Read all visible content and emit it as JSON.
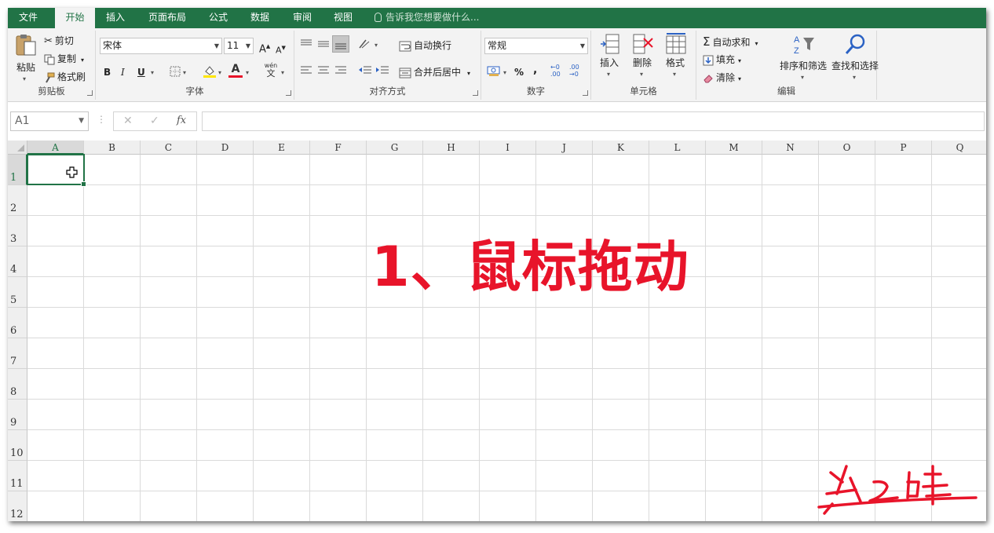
{
  "ribbon_tabs": [
    {
      "label": "文件"
    },
    {
      "label": "开始"
    },
    {
      "label": "插入"
    },
    {
      "label": "页面布局"
    },
    {
      "label": "公式"
    },
    {
      "label": "数据"
    },
    {
      "label": "审阅"
    },
    {
      "label": "视图"
    }
  ],
  "tell_me": "告诉我您想要做什么...",
  "clipboard": {
    "paste": "粘贴",
    "cut": "剪切",
    "copy": "复制",
    "format_painter": "格式刷",
    "group_label": "剪贴板"
  },
  "font": {
    "font_name": "宋体",
    "font_size": "11",
    "bold": "B",
    "italic": "I",
    "underline": "U",
    "grow": "A",
    "shrink": "A",
    "font_color_letter": "A",
    "phonetic_top": "wén",
    "phonetic_bottom": "文",
    "group_label": "字体"
  },
  "alignment": {
    "wrap_text": "自动换行",
    "merge_center": "合并后居中",
    "group_label": "对齐方式"
  },
  "number": {
    "format": "常规",
    "percent": "%",
    "comma": ",",
    "group_label": "数字"
  },
  "cells": {
    "insert": "插入",
    "delete": "删除",
    "format": "格式",
    "group_label": "单元格"
  },
  "editing": {
    "autosum": "自动求和",
    "fill": "填充",
    "clear": "清除",
    "sort_filter": "排序和筛选",
    "find_select": "查找和选择",
    "group_label": "编辑"
  },
  "formula_bar": {
    "name_box": "A1",
    "cancel": "✕",
    "enter": "✓",
    "fx": "fx",
    "formula": ""
  },
  "sheet": {
    "columns": [
      "A",
      "B",
      "C",
      "D",
      "E",
      "F",
      "G",
      "H",
      "I",
      "J",
      "K",
      "L",
      "M",
      "N",
      "O",
      "P",
      "Q"
    ],
    "rows": [
      "1",
      "2",
      "3",
      "4",
      "5",
      "6",
      "7",
      "8",
      "9",
      "10",
      "11",
      "12"
    ],
    "active_cell": "A1"
  },
  "overlay_caption": "1、鼠标拖动",
  "colors": {
    "accent": "#217346",
    "caption": "#e8142a"
  }
}
